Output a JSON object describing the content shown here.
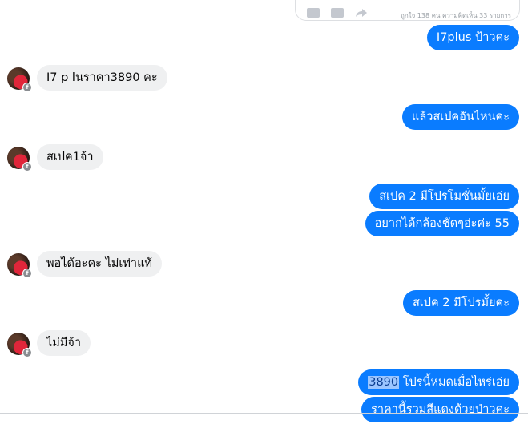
{
  "shared_post": {
    "stats": "ถูกใจ 138 คน ความคิดเห็น 33 รายการ",
    "actions": [
      "like-icon",
      "comment-icon",
      "share-icon"
    ]
  },
  "messages": {
    "m1": "I7plus ป้าวคะ",
    "m2": "I7 p lนราคา3890 คะ",
    "m3": "แล้วสเปคอันไหนคะ",
    "m4": "สเปค1จ้า",
    "m5": "สเปค 2 มีโปรโมชั่นมั้ยเอ่ย",
    "m6": "อยากได้กล้องชัดๆอ่ะค่ะ 55",
    "m7": "พอได้อะคะ ไม่เท่าแท้",
    "m8": "สเปค 2 มีโปรมั้ยคะ",
    "m9": "ไม่มีจ้า",
    "m10_highlight": "3890",
    "m10_rest": " โปรนี้หมดเมื่อไหร่เอ่ย",
    "m11": "ราคานี้รวมสีแดงด้วยป่าวคะ"
  },
  "colors": {
    "outgoing_bubble": "#0a7cff",
    "incoming_bubble": "#eff0f1"
  }
}
